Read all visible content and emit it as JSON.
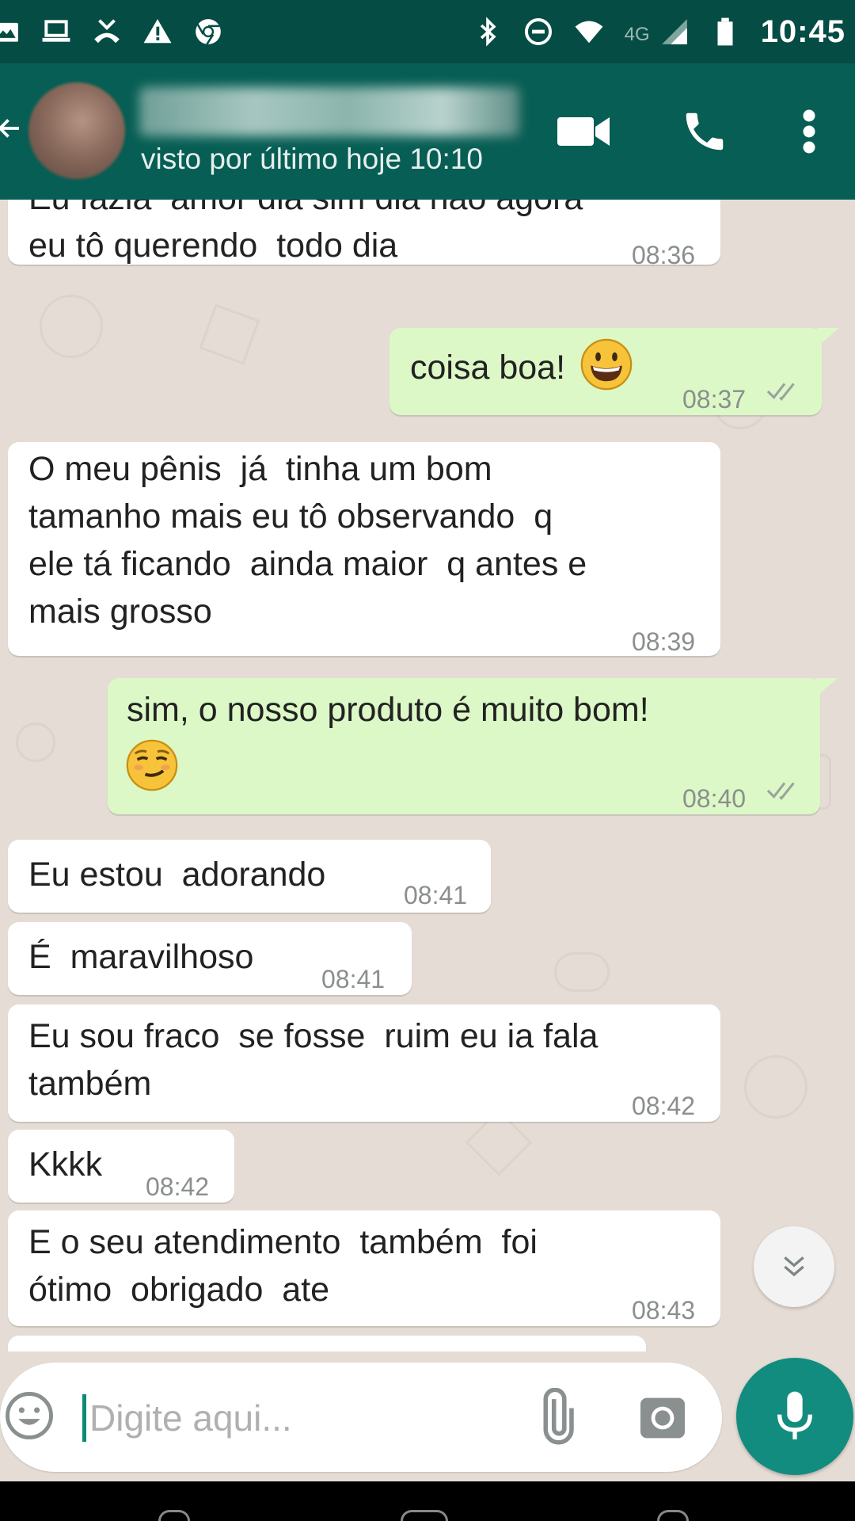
{
  "status_bar": {
    "time": "10:45",
    "network": "4G",
    "left_icons": [
      "image-icon",
      "laptop-icon",
      "missed-call-icon",
      "warning-icon",
      "chrome-icon"
    ],
    "right_icons": [
      "bluetooth-icon",
      "do-not-disturb-icon",
      "wifi-icon",
      "signal-icon",
      "battery-icon"
    ]
  },
  "header": {
    "contact_name": "",
    "last_seen": "visto por último hoje 10:10",
    "actions": [
      "video-call-icon",
      "phone-icon",
      "more-options-icon"
    ],
    "color": "#075e54"
  },
  "messages": [
    {
      "direction": "in",
      "text": "Eu fazia  amor dia sim dia não agora\neu tô querendo  todo dia",
      "time": "08:36"
    },
    {
      "direction": "out",
      "text": "coisa boa! ",
      "emoji": "grinning-face-emoji",
      "time": "08:37",
      "status": "read"
    },
    {
      "direction": "in",
      "text": "O meu pênis  já  tinha um bom\ntamanho mais eu tô observando  q\nele tá ficando  ainda maior  q antes e\nmais grosso",
      "time": "08:39"
    },
    {
      "direction": "out",
      "text": "sim, o nosso produto é muito bom!",
      "emoji": "smirking-face-emoji",
      "time": "08:40",
      "status": "read"
    },
    {
      "direction": "in",
      "text": "Eu estou  adorando",
      "time": "08:41"
    },
    {
      "direction": "in",
      "text": "É  maravilhoso",
      "time": "08:41"
    },
    {
      "direction": "in",
      "text": "Eu sou fraco  se fosse  ruim eu ia fala\ntambém",
      "time": "08:42"
    },
    {
      "direction": "in",
      "text": "Kkkk",
      "time": "08:42"
    },
    {
      "direction": "in",
      "text": "E o seu atendimento  também  foi\nótimo  obrigado  ate",
      "time": "08:43"
    }
  ],
  "input": {
    "placeholder": "Digite aqui...",
    "value": ""
  },
  "colors": {
    "status_bar": "#054d44",
    "incoming_bubble": "#ffffff",
    "outgoing_bubble": "#dcf8c6",
    "mic_button": "#128c7e",
    "chat_background": "#e5ddd5"
  }
}
